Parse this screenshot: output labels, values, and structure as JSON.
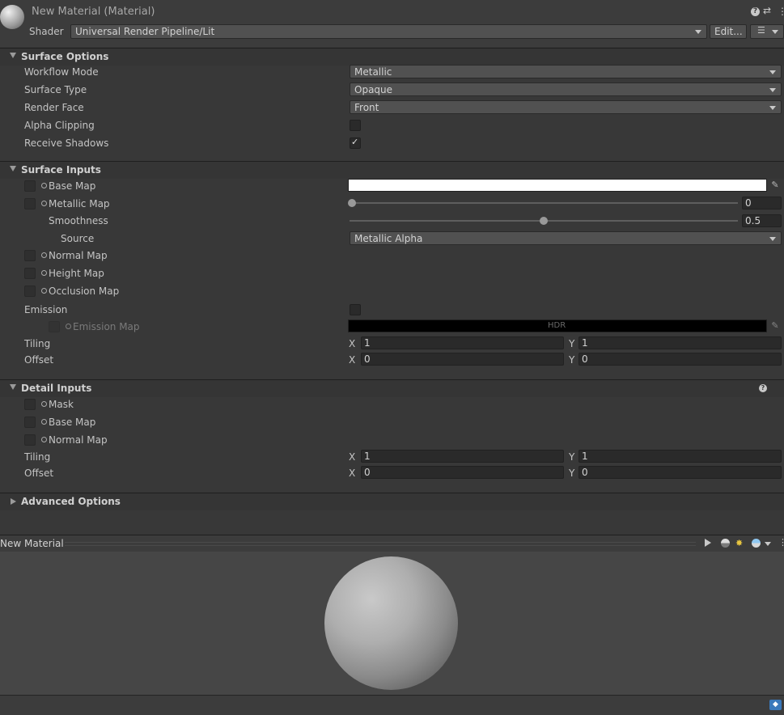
{
  "header": {
    "title": "New Material (Material)",
    "shader_label": "Shader",
    "shader_value": "Universal Render Pipeline/Lit",
    "edit_button": "Edit..."
  },
  "surface_options": {
    "title": "Surface Options",
    "workflow_label": "Workflow Mode",
    "workflow_value": "Metallic",
    "surface_type_label": "Surface Type",
    "surface_type_value": "Opaque",
    "render_face_label": "Render Face",
    "render_face_value": "Front",
    "alpha_clipping_label": "Alpha Clipping",
    "alpha_clipping_checked": false,
    "receive_shadows_label": "Receive Shadows",
    "receive_shadows_checked": true
  },
  "surface_inputs": {
    "title": "Surface Inputs",
    "base_map_label": "Base Map",
    "metallic_map_label": "Metallic Map",
    "metallic_value": "0",
    "smoothness_label": "Smoothness",
    "smoothness_value": "0.5",
    "source_label": "Source",
    "source_value": "Metallic Alpha",
    "normal_map_label": "Normal Map",
    "height_map_label": "Height Map",
    "occlusion_map_label": "Occlusion Map",
    "emission_label": "Emission",
    "emission_map_label": "Emission Map",
    "hdr_label": "HDR",
    "tiling_label": "Tiling",
    "tiling_x": "1",
    "tiling_y": "1",
    "offset_label": "Offset",
    "offset_x": "0",
    "offset_y": "0",
    "x_label": "X",
    "y_label": "Y"
  },
  "detail_inputs": {
    "title": "Detail Inputs",
    "mask_label": "Mask",
    "base_map_label": "Base Map",
    "normal_map_label": "Normal Map",
    "tiling_label": "Tiling",
    "tiling_x": "1",
    "tiling_y": "1",
    "offset_label": "Offset",
    "offset_x": "0",
    "offset_y": "0"
  },
  "advanced_options": {
    "title": "Advanced Options"
  },
  "preview": {
    "title": "New Material"
  },
  "colors": {
    "base_color": "#ffffff",
    "emission_color": "#000000",
    "accent": "#3a79bb"
  }
}
